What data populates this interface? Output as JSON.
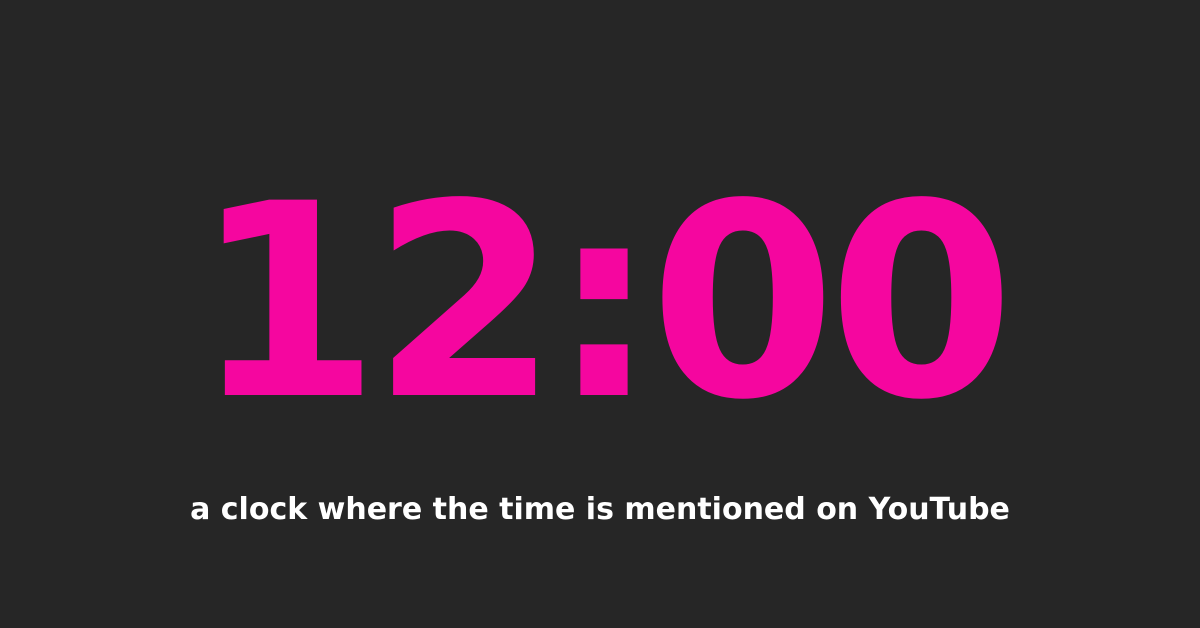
{
  "clock": {
    "time": "12:00"
  },
  "tagline": {
    "text": "a clock where the time is mentioned on YouTube"
  },
  "colors": {
    "background": "#262626",
    "time": "#f5069f",
    "tagline": "#ffffff"
  }
}
